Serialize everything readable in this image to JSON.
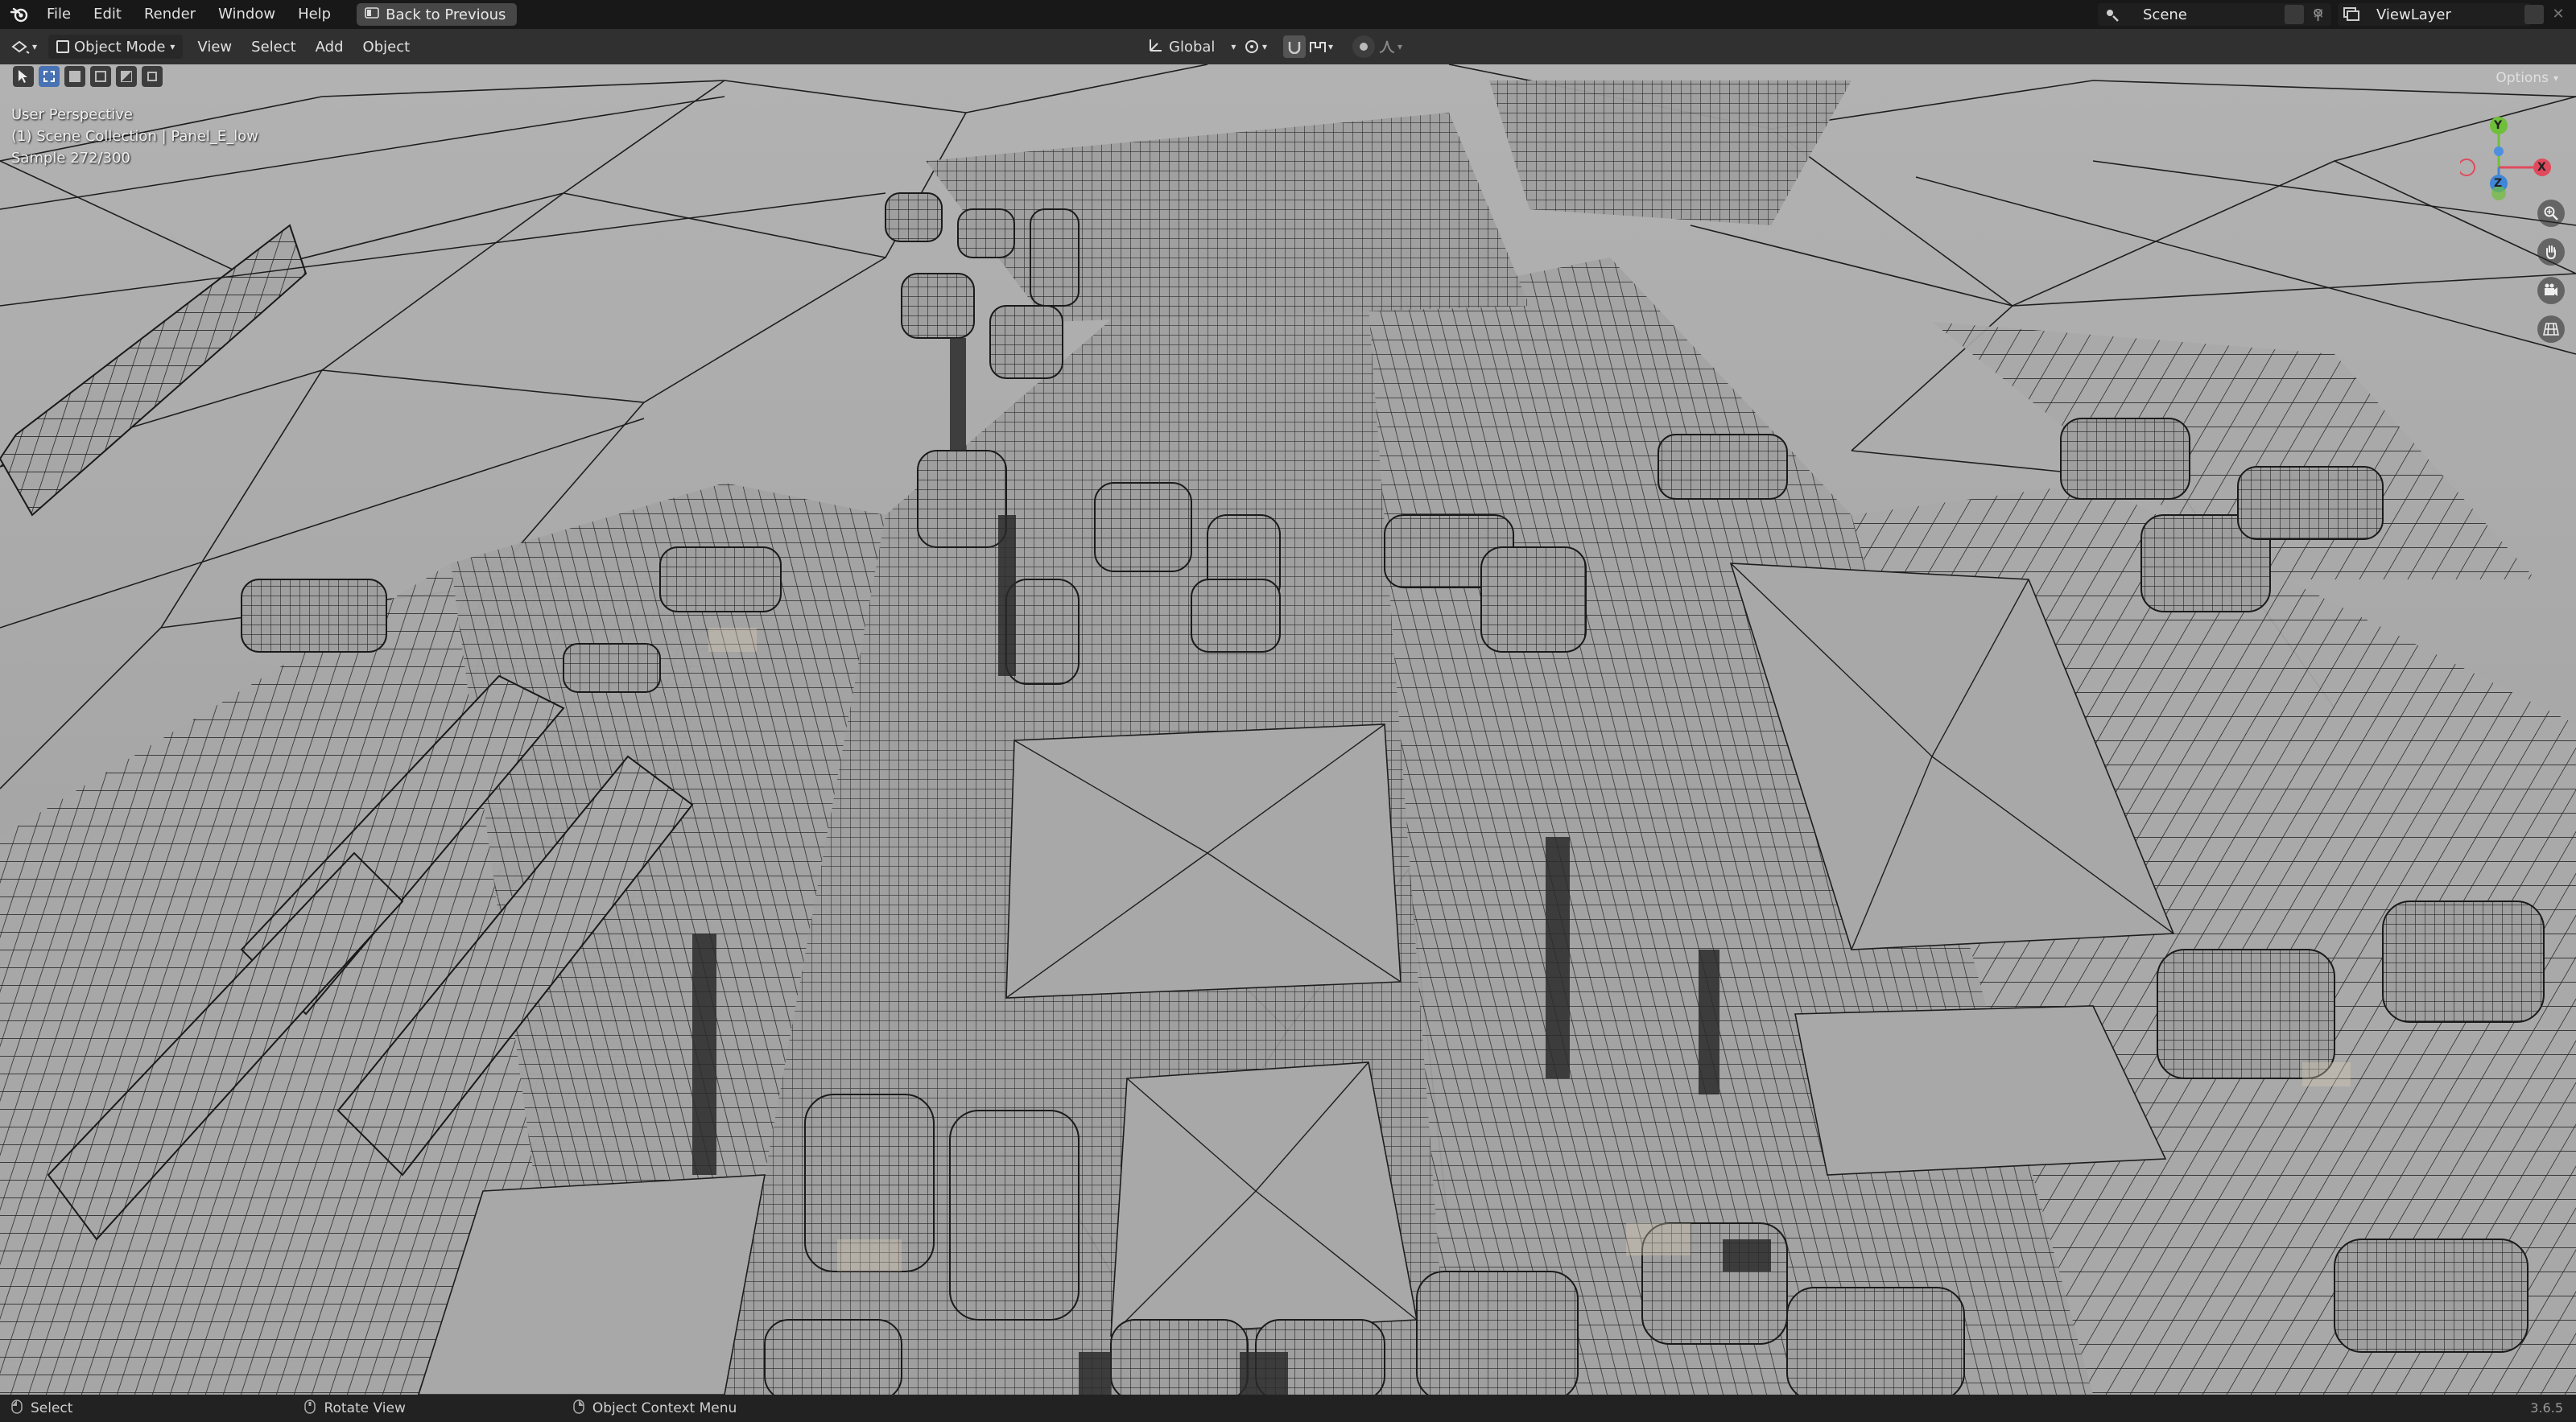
{
  "menu": {
    "items": [
      "File",
      "Edit",
      "Render",
      "Window",
      "Help"
    ],
    "back_button": "Back to Previous"
  },
  "scene": {
    "label": "Scene"
  },
  "view_layer": {
    "label": "ViewLayer"
  },
  "header": {
    "mode": "Object Mode",
    "menus": [
      "View",
      "Select",
      "Add",
      "Object"
    ],
    "orientation": "Global",
    "options_label": "Options"
  },
  "viewport": {
    "perspective": "User Perspective",
    "collection": "(1) Scene Collection | Panel_E_low",
    "sample": "Sample 272/300"
  },
  "gizmo": {
    "x_label": "X",
    "y_label": "Y",
    "z_label": "Z"
  },
  "status": {
    "select": "Select",
    "rotate": "Rotate View",
    "context": "Object Context Menu",
    "version": "3.6.5"
  },
  "colors": {
    "accent": "#4772b3",
    "axis_x": "#e04a5c",
    "axis_y": "#6fbf3a",
    "axis_z": "#3f86d8",
    "mesh_face": "#a9a9a9",
    "wire": "#1e1e1e"
  }
}
